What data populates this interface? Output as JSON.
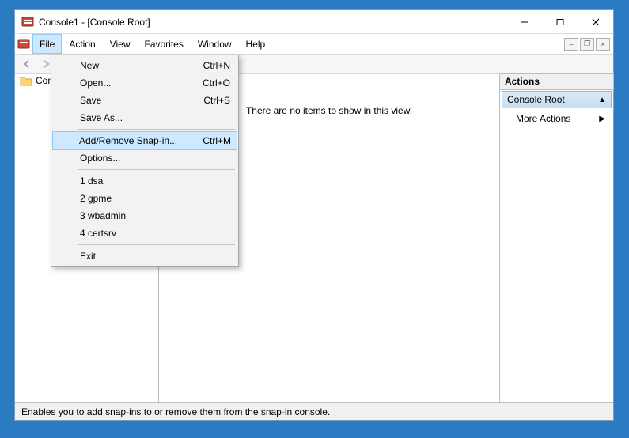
{
  "window": {
    "title": "Console1 - [Console Root]"
  },
  "menubar": {
    "file": "File",
    "action": "Action",
    "view": "View",
    "favorites": "Favorites",
    "window": "Window",
    "help": "Help"
  },
  "file_menu": {
    "new": {
      "label": "New",
      "shortcut": "Ctrl+N"
    },
    "open": {
      "label": "Open...",
      "shortcut": "Ctrl+O"
    },
    "save": {
      "label": "Save",
      "shortcut": "Ctrl+S"
    },
    "save_as": {
      "label": "Save As...",
      "shortcut": ""
    },
    "add_remove": {
      "label": "Add/Remove Snap-in...",
      "shortcut": "Ctrl+M"
    },
    "options": {
      "label": "Options...",
      "shortcut": ""
    },
    "recent1": {
      "label": "1 dsa"
    },
    "recent2": {
      "label": "2 gpme"
    },
    "recent3": {
      "label": "3 wbadmin"
    },
    "recent4": {
      "label": "4 certsrv"
    },
    "exit": {
      "label": "Exit"
    }
  },
  "tree": {
    "root_label": "Console Root"
  },
  "center": {
    "empty_message": "There are no items to show in this view."
  },
  "actions": {
    "header": "Actions",
    "group_label": "Console Root",
    "more_actions": "More Actions"
  },
  "statusbar": {
    "text": "Enables you to add snap-ins to or remove them from the snap-in console."
  }
}
